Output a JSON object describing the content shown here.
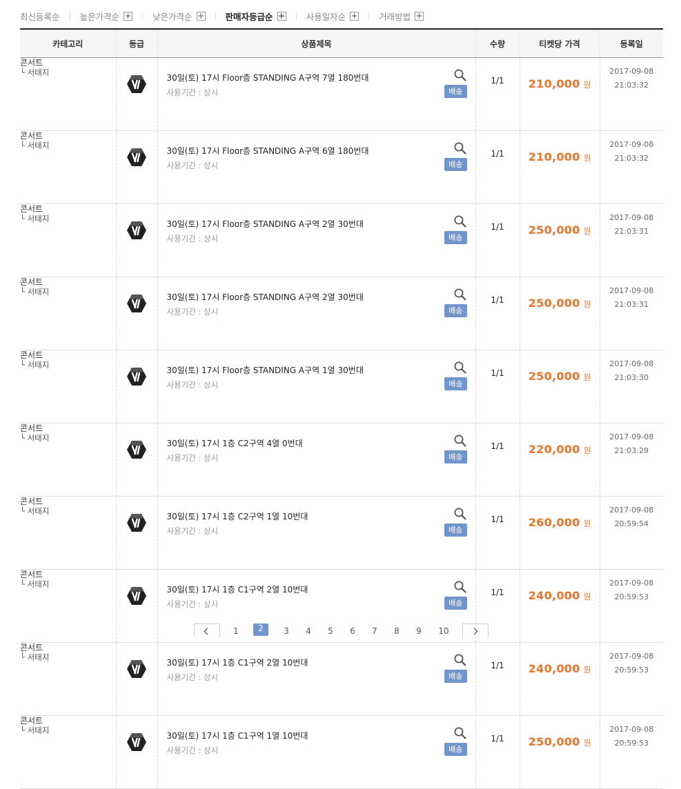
{
  "sort": [
    {
      "label": "최신등록순",
      "plus": false,
      "active": false
    },
    {
      "label": "높은가격순",
      "plus": true,
      "active": false
    },
    {
      "label": "낮은가격순",
      "plus": true,
      "active": false
    },
    {
      "label": "판매자등급순",
      "plus": true,
      "active": true
    },
    {
      "label": "사용일자순",
      "plus": true,
      "active": false
    },
    {
      "label": "거래방법",
      "plus": true,
      "active": false
    }
  ],
  "table": {
    "headers": [
      "카테고리",
      "등급",
      "상품제목",
      "수량",
      "티켓당 가격",
      "등록일"
    ]
  },
  "rows": [
    {
      "cat": "콘서트",
      "sub": "└ 서태지",
      "title": "30일(토) 17시 Floor층 STANDING A구역 7열 180번대",
      "period": "사용기간 : 상시",
      "ship": "배송",
      "qty": "1/1",
      "price": "210,000",
      "unit": "원",
      "date": "2017-09-08",
      "time": "21:03:32"
    },
    {
      "cat": "콘서트",
      "sub": "└ 서태지",
      "title": "30일(토) 17시 Floor층 STANDING A구역 6열 180번대",
      "period": "사용기간 : 상시",
      "ship": "배송",
      "qty": "1/1",
      "price": "210,000",
      "unit": "원",
      "date": "2017-09-08",
      "time": "21:03:32"
    },
    {
      "cat": "콘서트",
      "sub": "└ 서태지",
      "title": "30일(토) 17시 Floor층 STANDING A구역 2열 30번대",
      "period": "사용기간 : 상시",
      "ship": "배송",
      "qty": "1/1",
      "price": "250,000",
      "unit": "원",
      "date": "2017-09-08",
      "time": "21:03:31"
    },
    {
      "cat": "콘서트",
      "sub": "└ 서태지",
      "title": "30일(토) 17시 Floor층 STANDING A구역 2열 30번대",
      "period": "사용기간 : 상시",
      "ship": "배송",
      "qty": "1/1",
      "price": "250,000",
      "unit": "원",
      "date": "2017-09-08",
      "time": "21:03:31"
    },
    {
      "cat": "콘서트",
      "sub": "└ 서태지",
      "title": "30일(토) 17시 Floor층 STANDING A구역 1열 30번대",
      "period": "사용기간 : 상시",
      "ship": "배송",
      "qty": "1/1",
      "price": "250,000",
      "unit": "원",
      "date": "2017-09-08",
      "time": "21:03:30"
    },
    {
      "cat": "콘서트",
      "sub": "└ 서태지",
      "title": "30일(토) 17시 1층 C2구역 4열 0번대",
      "period": "사용기간 : 상시",
      "ship": "배송",
      "qty": "1/1",
      "price": "220,000",
      "unit": "원",
      "date": "2017-09-08",
      "time": "21:03:29"
    },
    {
      "cat": "콘서트",
      "sub": "└ 서태지",
      "title": "30일(토) 17시 1층 C2구역 1열 10번대",
      "period": "사용기간 : 상시",
      "ship": "배송",
      "qty": "1/1",
      "price": "260,000",
      "unit": "원",
      "date": "2017-09-08",
      "time": "20:59:54"
    },
    {
      "cat": "콘서트",
      "sub": "└ 서태지",
      "title": "30일(토) 17시 1층 C1구역 2열 10번대",
      "period": "사용기간 : 상시",
      "ship": "배송",
      "qty": "1/1",
      "price": "240,000",
      "unit": "원",
      "date": "2017-09-08",
      "time": "20:59:53"
    },
    {
      "cat": "콘서트",
      "sub": "└ 서태지",
      "title": "30일(토) 17시 1층 C1구역 2열 10번대",
      "period": "사용기간 : 상시",
      "ship": "배송",
      "qty": "1/1",
      "price": "240,000",
      "unit": "원",
      "date": "2017-09-08",
      "time": "20:59:53"
    },
    {
      "cat": "콘서트",
      "sub": "└ 서태지",
      "title": "30일(토) 17시 1층 C1구역 1열 10번대",
      "period": "사용기간 : 상시",
      "ship": "배송",
      "qty": "1/1",
      "price": "250,000",
      "unit": "원",
      "date": "2017-09-08",
      "time": "20:59:53"
    }
  ],
  "icons": {
    "grade": "vip-grade-icon",
    "search": "search-icon",
    "prev": "chevron-left-icon",
    "next": "chevron-right-icon"
  },
  "colors": {
    "accent": "#e8742a",
    "ship_badge": "#6f95cc",
    "grade_badge": "#222222"
  },
  "pagination": {
    "pages": [
      "1",
      "2",
      "3",
      "4",
      "5",
      "6",
      "7",
      "8",
      "9",
      "10"
    ],
    "current": "2"
  }
}
